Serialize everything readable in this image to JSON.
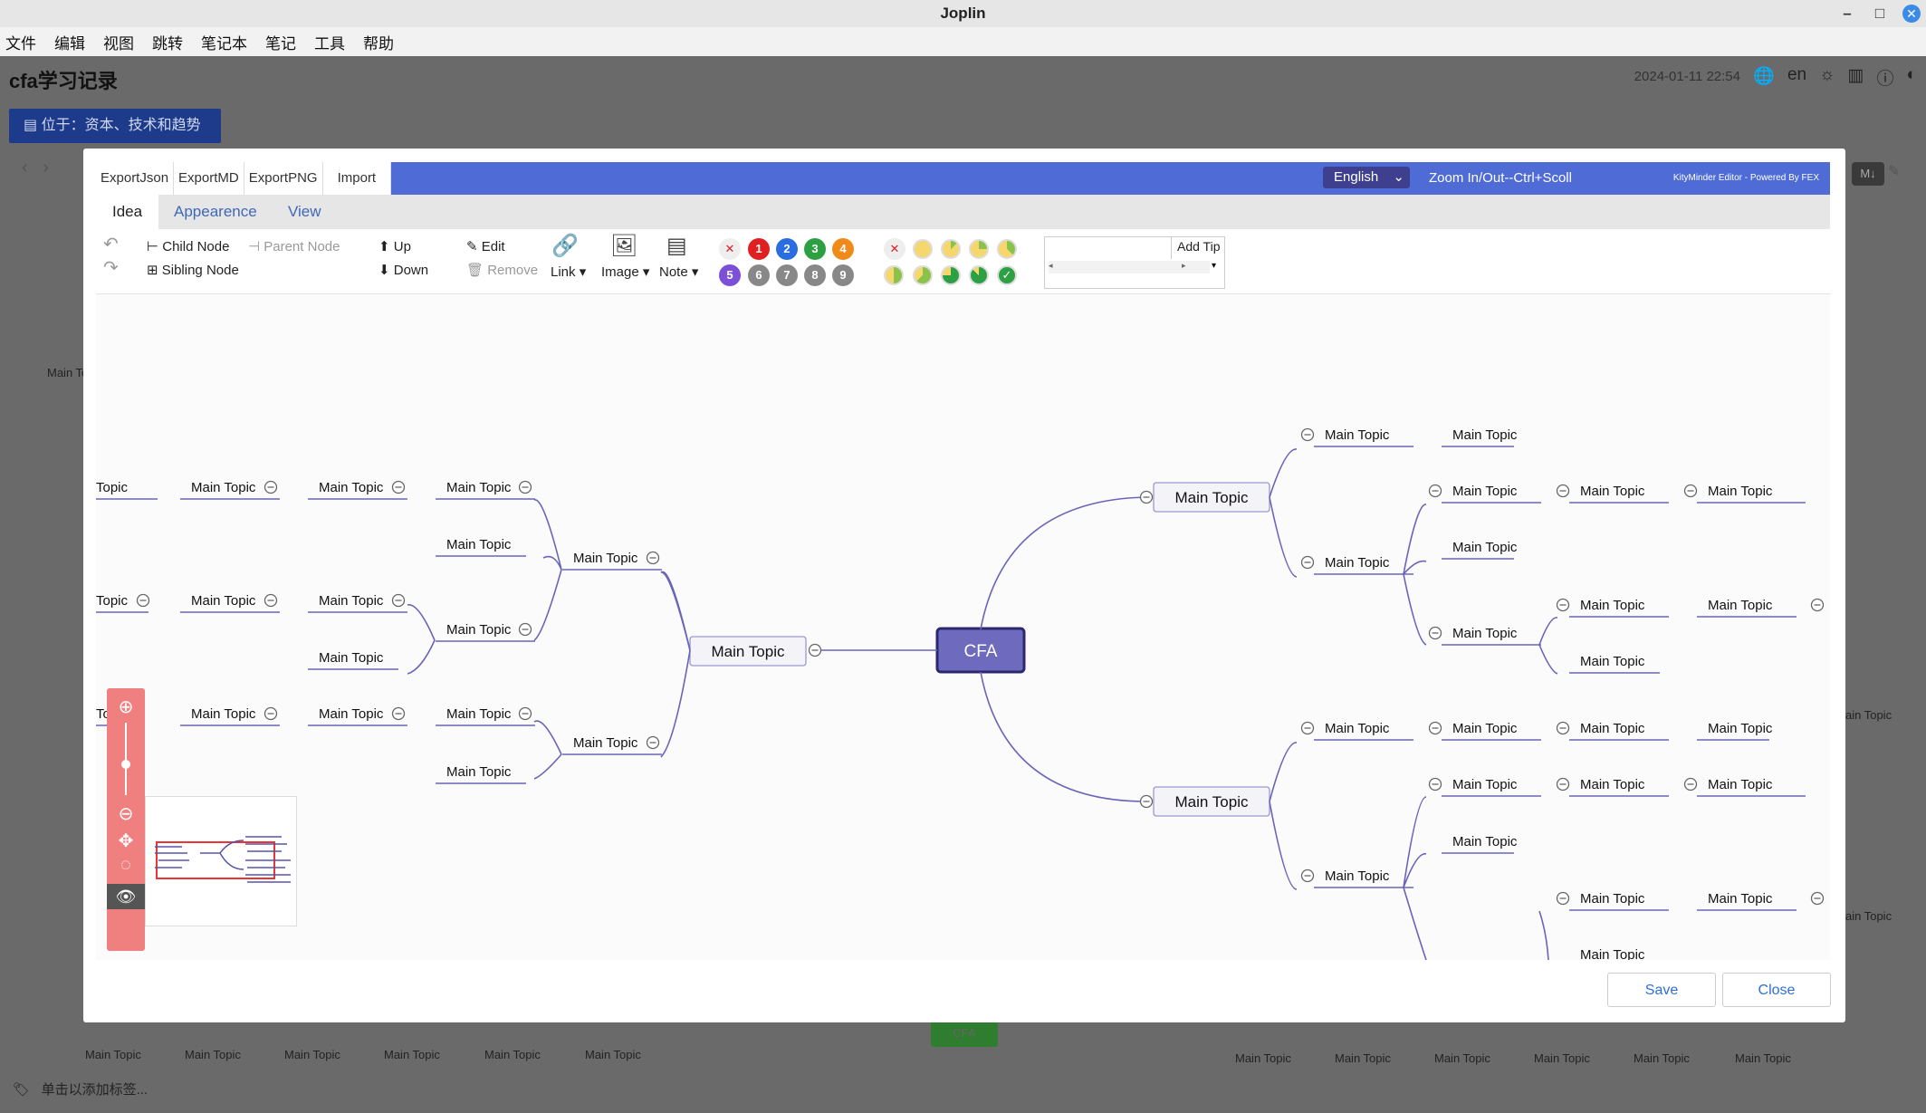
{
  "window": {
    "title": "Joplin",
    "min": "–",
    "max": "□",
    "close": "✕"
  },
  "menu": [
    "文件",
    "编辑",
    "视图",
    "跳转",
    "笔记本",
    "笔记",
    "工具",
    "帮助"
  ],
  "note": {
    "title": "cfa学习记录",
    "date": "2024-01-11 22:54",
    "lang": "en",
    "location": "位于：资本、技术和趋势",
    "tag_hint": "单击以添加标签..."
  },
  "editor": {
    "export_tabs": [
      "ExportJson",
      "ExportMD",
      "ExportPNG",
      "Import"
    ],
    "language": "English",
    "zoom_hint": "Zoom In/Out--Ctrl+Scoll",
    "powered": "KityMinder Editor - Powered By FEX",
    "tabs": [
      "Idea",
      "Appearence",
      "View"
    ],
    "tools": {
      "child": "Child Node",
      "parent": "Parent Node",
      "sibling": "Sibling Node",
      "up": "Up",
      "down": "Down",
      "edit": "Edit",
      "remove": "Remove",
      "link": "Link",
      "image": "Image",
      "note": "Note",
      "addtip": "Add Tip"
    },
    "priorities": [
      "1",
      "2",
      "3",
      "4",
      "5",
      "6",
      "7",
      "8",
      "9"
    ],
    "priority_colors": [
      "#e02020",
      "#2a6de0",
      "#2ea044",
      "#f08a1a",
      "#7b4fd8",
      "#888888",
      "#888888",
      "#888888",
      "#888888"
    ],
    "root": "CFA",
    "topic": "Main Topic",
    "topic_short": "Topic",
    "topic_to": "To"
  },
  "bg_labels": [
    "Main To",
    "Main Topic",
    "ain Topic",
    "CFA"
  ],
  "buttons": {
    "save": "Save",
    "close": "Close"
  }
}
